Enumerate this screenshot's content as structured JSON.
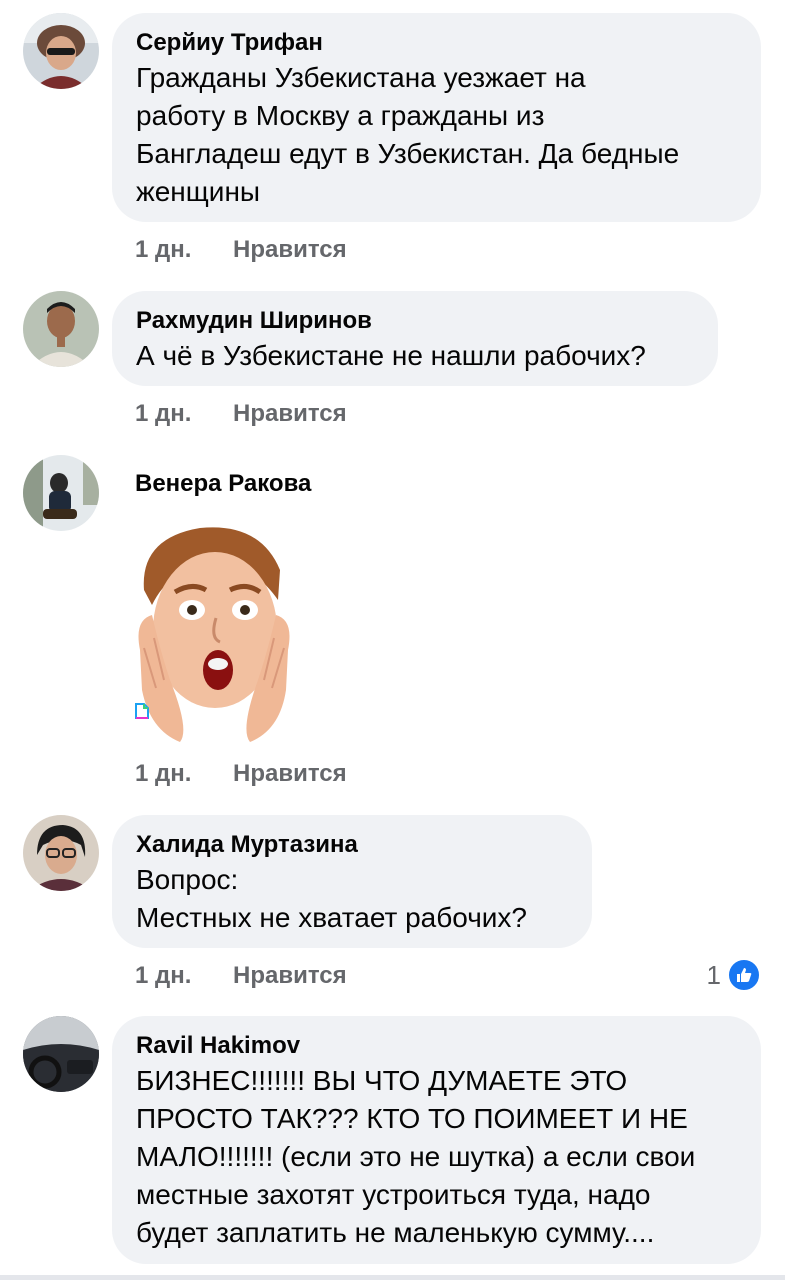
{
  "comments": [
    {
      "author": "Серйиу Трифан",
      "text": "Гражданы Узбекистана уезжает на\nработу в Москву а гражданы из\nБангладеш едут в Узбекистан. Да бедные\nженщины",
      "time": "1 дн.",
      "like_label": "Нравится",
      "avatar_icon": "person-fur-hat-avatar"
    },
    {
      "author": "Рахмудин Ширинов",
      "text": "А чё в Узбекистане не нашли рабочих?",
      "time": "1 дн.",
      "like_label": "Нравится",
      "avatar_icon": "person-portrait-avatar"
    },
    {
      "author": "Венера Ракова",
      "sticker_icon": "surprised-boy-sticker",
      "time": "1 дн.",
      "like_label": "Нравится",
      "avatar_icon": "child-snow-avatar"
    },
    {
      "author": "Халида Муртазина",
      "text": "Вопрос:\nМестных не хватает рабочих?",
      "time": "1 дн.",
      "like_label": "Нравится",
      "reaction_count": "1",
      "reaction_icon": "thumbs-up-icon",
      "avatar_icon": "woman-glasses-avatar"
    },
    {
      "author": "Ravil Hakimov",
      "text": "БИЗНЕС!!!!!!! ВЫ ЧТО ДУМАЕТЕ ЭТО\nПРОСТО ТАК??? КТО ТО ПОИМЕЕТ  И НЕ\nМАЛО!!!!!!! (если это не шутка) а если свои\nместные захотят устроиться туда, надо\nбудет заплатить не маленькую сумму....",
      "avatar_icon": "car-interior-avatar"
    }
  ],
  "colors": {
    "bubble": "#f0f2f5",
    "meta": "#65676b",
    "like_blue": "#1877f2"
  }
}
